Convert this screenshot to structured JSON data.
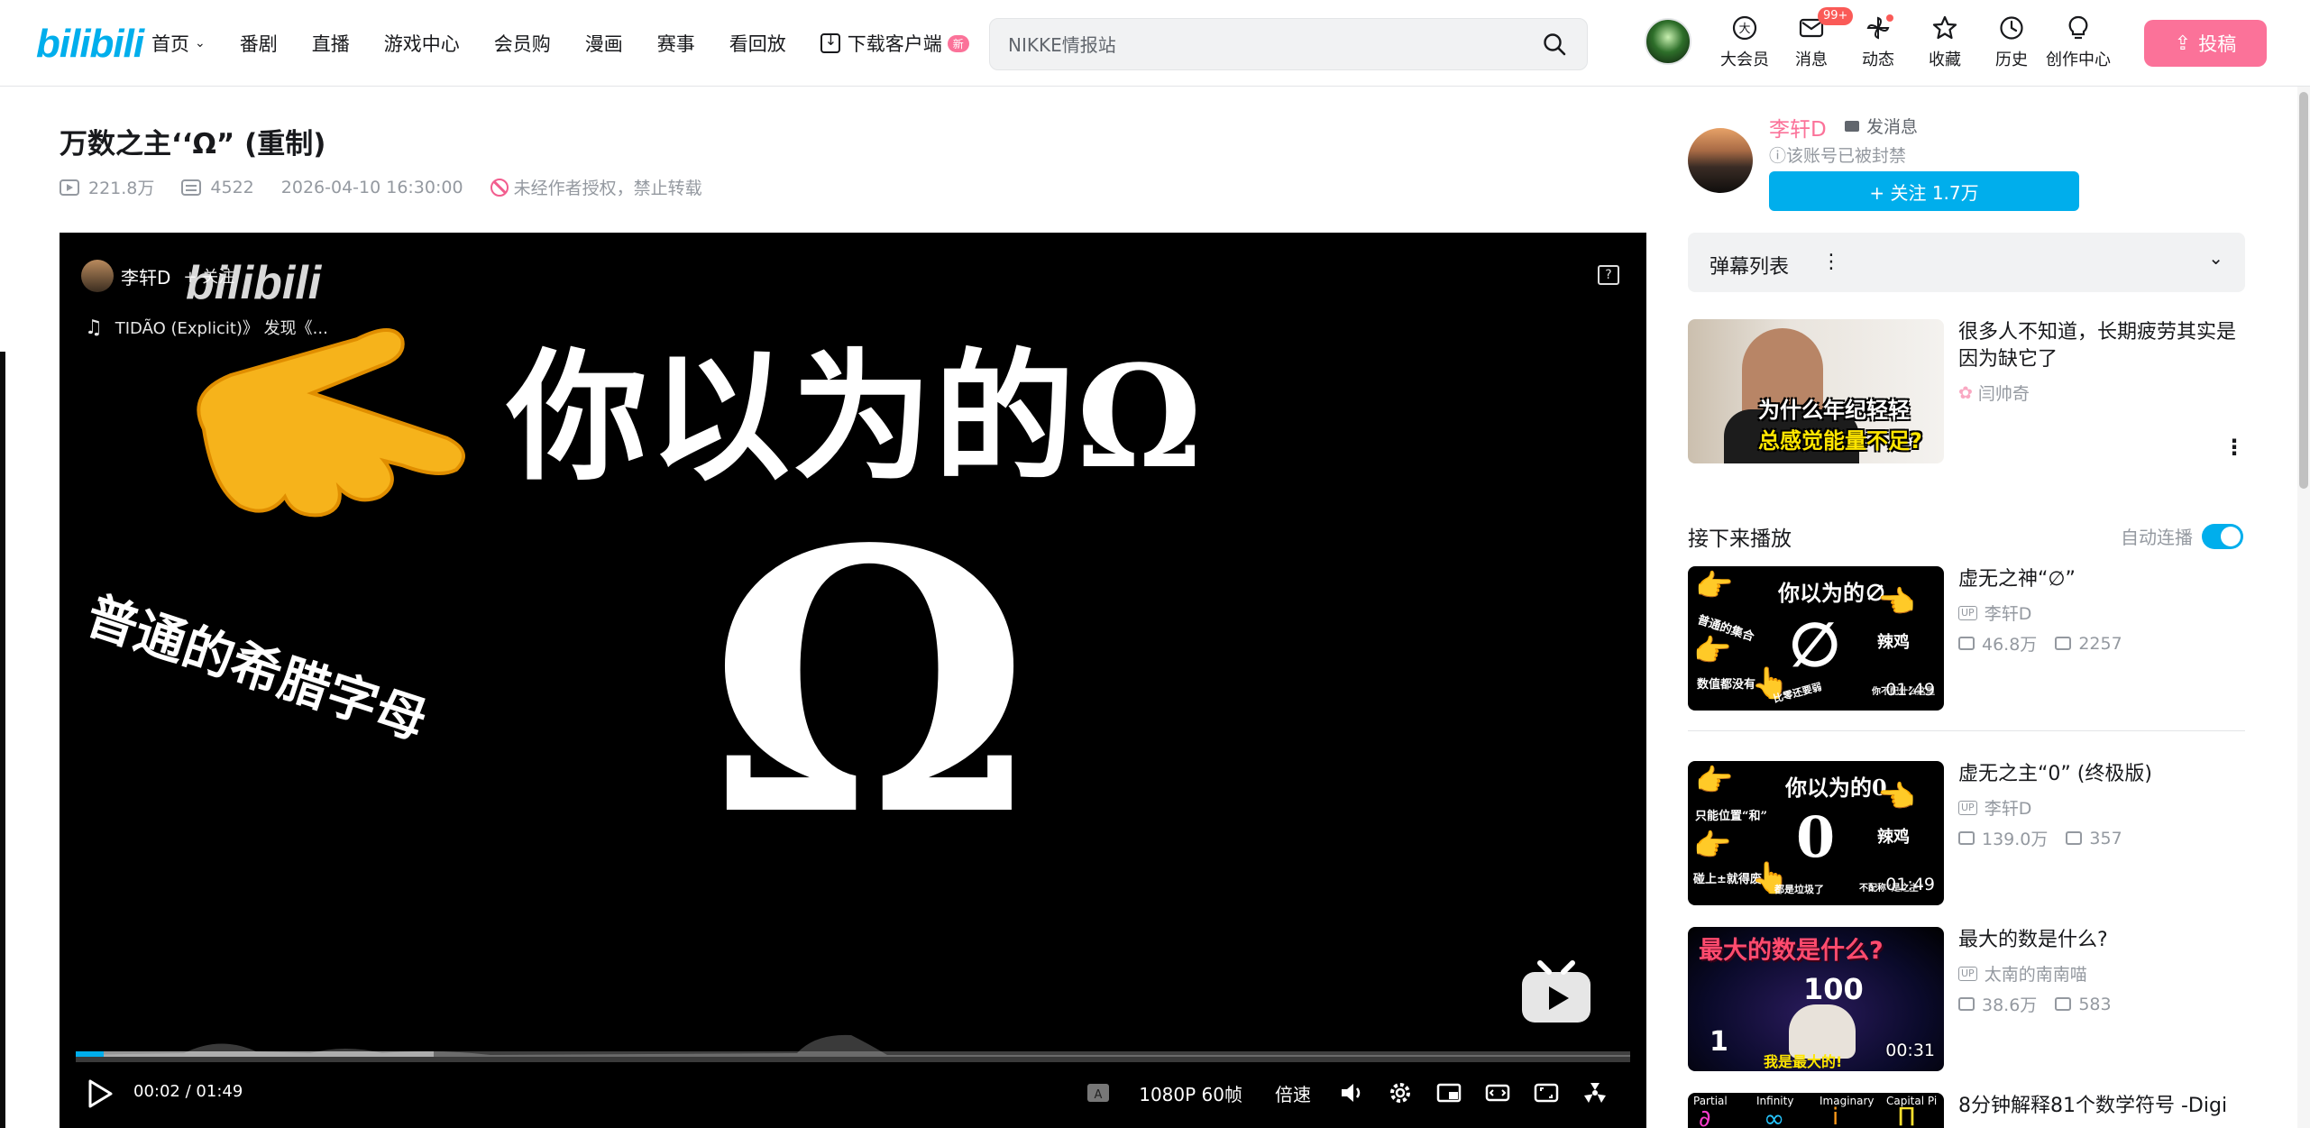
{
  "brand": {
    "logo_text": "bilibili",
    "accent": "#00aeec",
    "pink": "#fb7299"
  },
  "nav": {
    "items": [
      "首页",
      "番剧",
      "直播",
      "游戏中心",
      "会员购",
      "漫画",
      "赛事",
      "看回放"
    ],
    "download_label": "下载客户端",
    "new_badge": "新"
  },
  "search": {
    "placeholder": "NIKKE情报站"
  },
  "header_icons": {
    "vip": "大会员",
    "messages": "消息",
    "messages_badge": "99+",
    "dynamics": "动态",
    "favorites": "收藏",
    "history": "历史",
    "creator": "创作中心"
  },
  "upload_label": "投稿",
  "video": {
    "title": "万数之主‘‘Ω” (重制)",
    "views": "221.8万",
    "danmaku": "4522",
    "date": "2026-04-10 16:30:00",
    "copyright": "未经作者授权，禁止转载"
  },
  "player": {
    "overlay_up": "李轩D",
    "overlay_follow": "+ 关注",
    "watermark": "bilibili",
    "music": "TIDÃO (Explicit)》 发现《...",
    "frame_main_text": "你以为的Ω",
    "frame_side_text": "普通的希腊字母",
    "frame_glyph": "Ω",
    "help_icon": "?",
    "progress_played": 0.018,
    "progress_buffered": 0.23,
    "time_current": "00:02",
    "time_sep": "/",
    "time_total": "01:49",
    "quality": "1080P 60帧",
    "speed": "倍速"
  },
  "uploader": {
    "name": "李轩D",
    "send_message": "发消息",
    "banned_notice": "ⓘ该账号已被封禁",
    "follow_label": "+ 关注 1.7万"
  },
  "danmaku_list": {
    "label": "弹幕列表",
    "more": "⋮",
    "chevron": "⌄"
  },
  "ad": {
    "title": "很多人不知道，长期疲劳其实是因为缺它了",
    "author": "闫帅奇",
    "caption_line1": "为什么年纪轻轻",
    "caption_line2": "总感觉能量不足?",
    "menu": "⋮"
  },
  "next_up": {
    "label": "接下来播放",
    "autoplay_label": "自动连播"
  },
  "recommendations": [
    {
      "title": "虚无之神“∅”",
      "up": "李轩D",
      "views": "46.8万",
      "danmaku": "2257",
      "duration": "01:49",
      "thumb_main": "你以为的∅",
      "thumb_glyph": "∅",
      "thumb_note_a": "普通的集合",
      "thumb_note_b": "辣鸡",
      "thumb_note_c": "数值都没有",
      "thumb_note_d": "比零还要弱",
      "thumb_note_e": "你不配什么这里"
    },
    {
      "title": "虚无之主“0” (终极版)",
      "up": "李轩D",
      "views": "139.0万",
      "danmaku": "357",
      "duration": "01:49",
      "thumb_main": "你以为的0",
      "thumb_glyph": "0",
      "thumb_note_a": "只能位置“和”",
      "thumb_note_b": "辣鸡",
      "thumb_note_c": "碰上±就得废",
      "thumb_note_d": "都是垃圾了",
      "thumb_note_e": "不配称“是之主”"
    },
    {
      "title": "最大的数是什么?",
      "up": "太南的南南喵",
      "views": "38.6万",
      "danmaku": "583",
      "duration": "00:31",
      "thumb_main": "最大的数是什么?",
      "thumb_number": "100",
      "thumb_one": "1",
      "thumb_sub": "我是最大的!"
    },
    {
      "title": "8分钟解释81个数学符号 -Digi",
      "thumb_labels": [
        "Partial",
        "Infinity",
        "Imaginary",
        "Capital Pi"
      ]
    }
  ]
}
